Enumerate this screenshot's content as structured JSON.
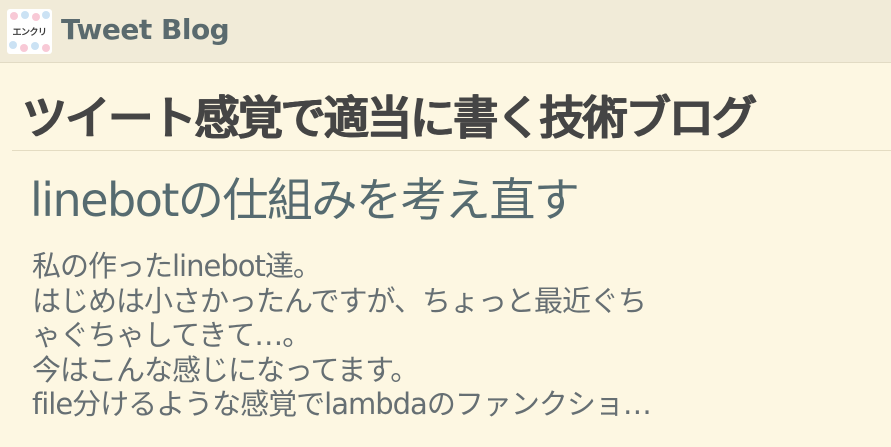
{
  "header": {
    "logo_text": "エンクリ",
    "site_name": "Tweet Blog"
  },
  "tagline": "ツイート感覚で適当に書く技術ブログ",
  "post": {
    "title": "linebotの仕組みを考え直す",
    "excerpt_lines": [
      "私の作ったlinebot達。",
      "はじめは小さかったんですが、ちょっと最近ぐち",
      "ゃぐちゃしてきて…。",
      "今はこんな感じになってます。",
      "file分けるような感覚でlambdaのファンクショ…"
    ]
  },
  "colors": {
    "page_background": "#fdf7e2",
    "header_background": "#f1ebd8",
    "site_name": "#5a6a6e",
    "tagline": "#454545",
    "title": "#566b70",
    "excerpt": "#666f73"
  }
}
